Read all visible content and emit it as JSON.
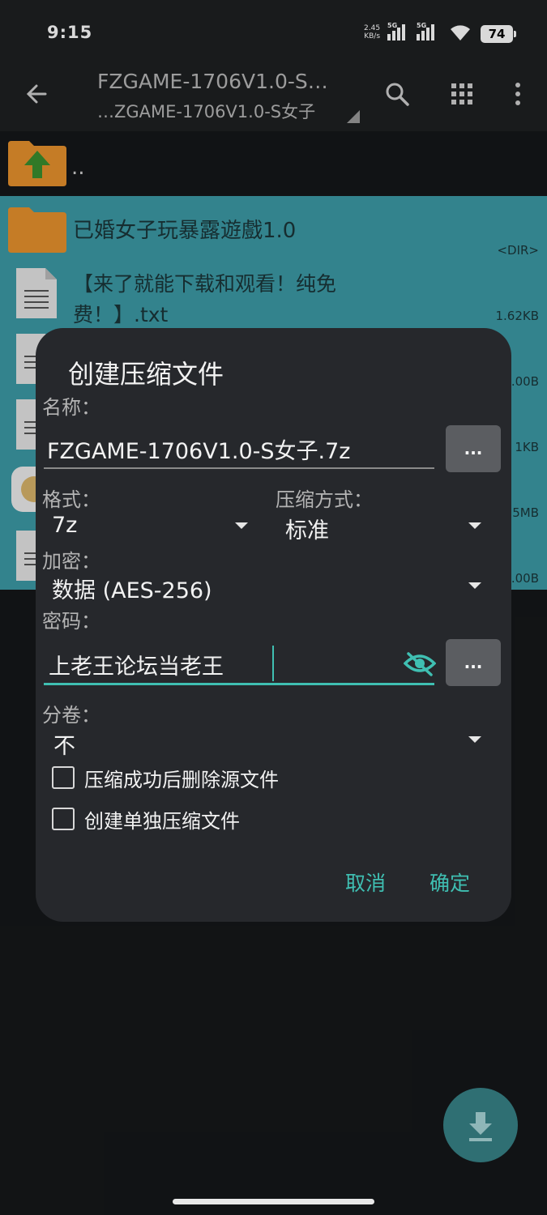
{
  "status": {
    "time": "9:15",
    "net_speed_value": "2.45",
    "net_speed_unit": "KB/s",
    "signal1_tag": "5G",
    "signal2_tag": "5G",
    "battery": "74"
  },
  "toolbar": {
    "title_line1": "FZGAME-1706V1.0-S…",
    "title_line2": "…ZGAME-1706V1.0-S女子"
  },
  "files": {
    "parent": "..",
    "items": [
      {
        "name": "已婚女子玩暴露遊戲1.0",
        "meta": "<DIR>"
      },
      {
        "name_line1": "【来了就能下载和观看！纯免",
        "name_line2": "费！】.txt",
        "meta": "1.62KB"
      },
      {
        "meta": ".00B"
      },
      {
        "meta": "1KB"
      },
      {
        "meta": "5MB"
      },
      {
        "meta": ".00B"
      }
    ]
  },
  "dialog": {
    "title": "创建压缩文件",
    "name_label": "名称：",
    "name_value": "FZGAME-1706V1.0-S女子.7z",
    "browse_label": "...",
    "format_label": "格式：",
    "format_value": "7z",
    "method_label": "压缩方式：",
    "method_value": "标准",
    "encryption_label": "加密：",
    "encryption_value": "数据 (AES-256)",
    "password_label": "密码：",
    "password_value": "上老王论坛当老王",
    "password_more_label": "...",
    "split_label": "分卷：",
    "split_value": "不",
    "delete_source_label": "压缩成功后删除源文件",
    "separate_archive_label": "创建单独压缩文件",
    "cancel_label": "取消",
    "ok_label": "确定"
  },
  "colors": {
    "accent": "#3fbfb2",
    "selected_row": "#3d9aa6",
    "dialog_bg": "#26282c",
    "folder": "#e8922d"
  }
}
